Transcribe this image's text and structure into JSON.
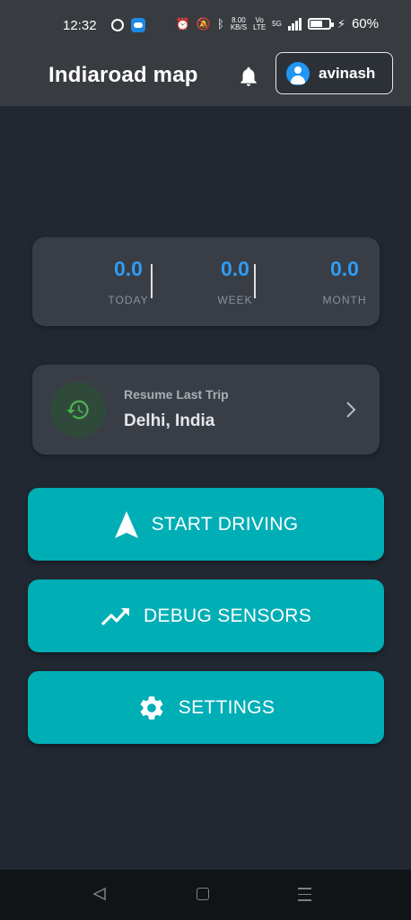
{
  "status_bar": {
    "time": "12:32",
    "net_speed_value": "8.00",
    "net_speed_unit": "KB/S",
    "volte_top": "Vo",
    "volte_bottom": "LTE",
    "network": "5G",
    "battery_percent": "60%"
  },
  "app_bar": {
    "title": "Indiaroad map",
    "user_name": "avinash"
  },
  "stats": {
    "today": {
      "value": "0.0",
      "label": "TODAY"
    },
    "week": {
      "value": "0.0",
      "label": "WEEK"
    },
    "month": {
      "value": "0.0",
      "label": "MONTH"
    }
  },
  "resume": {
    "label": "Resume Last Trip",
    "location": "Delhi, India"
  },
  "buttons": {
    "start_driving": "START DRIVING",
    "debug_sensors": "DEBUG SENSORS",
    "settings": "SETTINGS"
  },
  "colors": {
    "background": "#222832",
    "app_bar": "#383b40",
    "card": "#393e46",
    "accent_teal": "#00aeb6",
    "stat_blue": "#2f9cf4",
    "history_green": "#4caf50"
  },
  "icons": {
    "bell": "bell-icon",
    "avatar": "person-icon",
    "history": "history-icon",
    "chevron": "chevron-right-icon",
    "navigation": "navigation-arrow-icon",
    "trend": "trending-up-icon",
    "gear": "gear-icon"
  }
}
